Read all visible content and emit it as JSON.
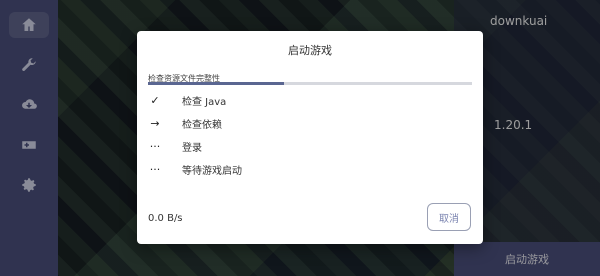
{
  "dialog": {
    "title": "启动游戏",
    "progress_label": "检查资源文件完整性",
    "progress": 0.42,
    "tasks": [
      {
        "icon": "check-icon",
        "label": "检查 Java",
        "glyph": "✓"
      },
      {
        "icon": "arrow-right-icon",
        "label": "检查依赖",
        "glyph": "→"
      },
      {
        "icon": "more-icon",
        "label": "登录",
        "glyph": "···"
      },
      {
        "icon": "more-icon",
        "label": "等待游戏启动",
        "glyph": "···"
      }
    ],
    "speed": "0.0 B/s",
    "cancel_label": "取消"
  },
  "right_panel": {
    "username": "downkuai",
    "version": "1.20.1",
    "launch_label": "启动游戏"
  },
  "colors": {
    "accent": "#5a6691",
    "rail": "#4a4f7c"
  }
}
